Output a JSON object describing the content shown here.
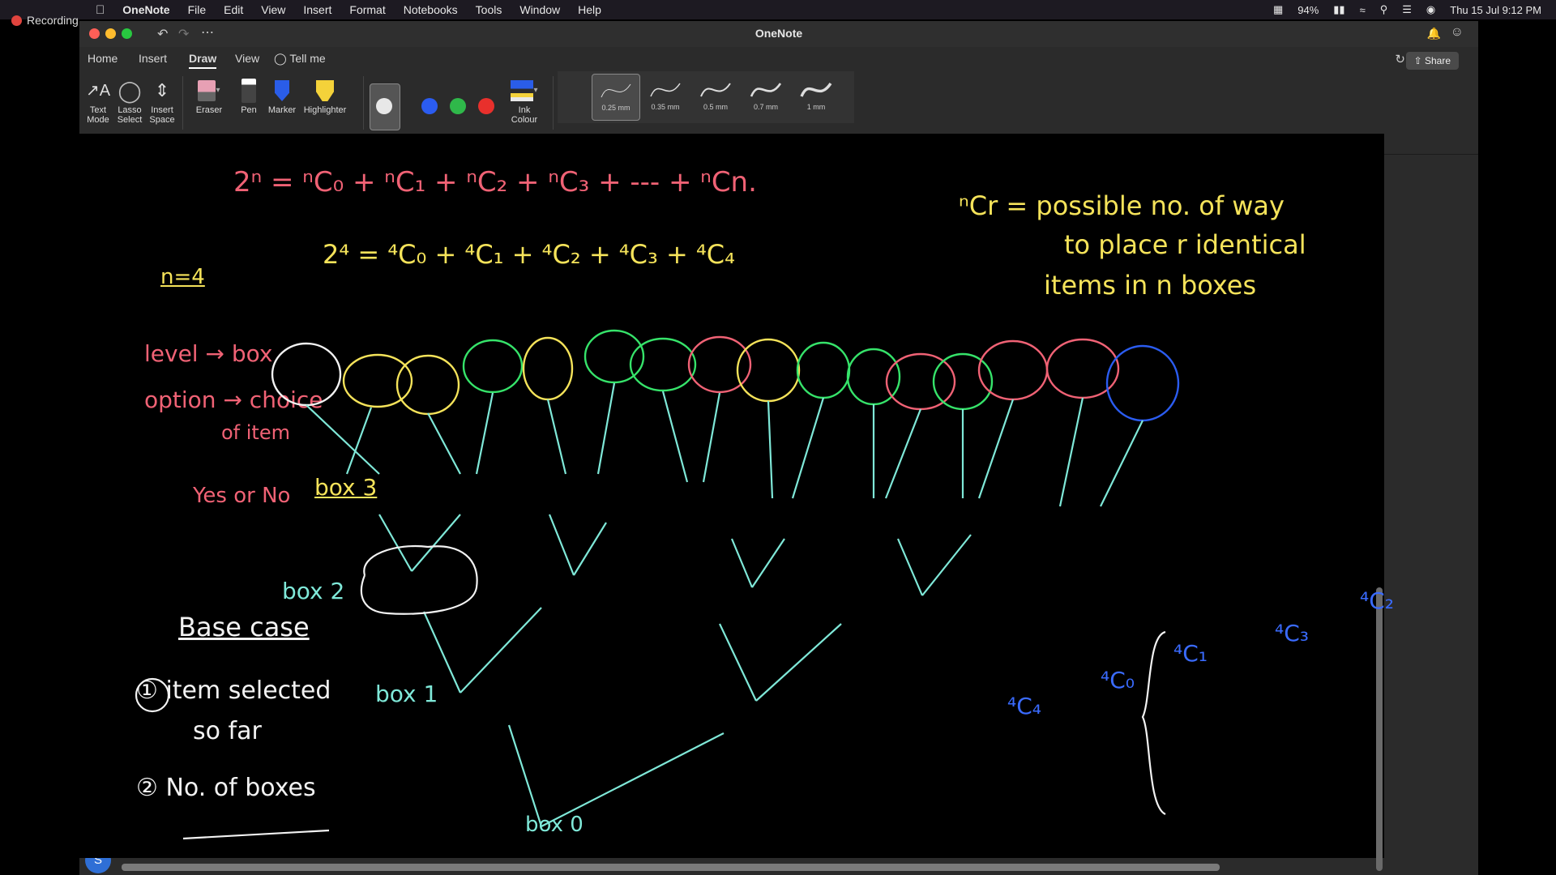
{
  "recording": {
    "label": "Recording"
  },
  "menubar": {
    "app": "OneNote",
    "items": [
      "File",
      "Edit",
      "View",
      "Insert",
      "Format",
      "Notebooks",
      "Tools",
      "Window",
      "Help"
    ],
    "battery": "94%",
    "datetime": "Thu 15 Jul  9:12 PM"
  },
  "window": {
    "title": "OneNote"
  },
  "tabs": [
    "Home",
    "Insert",
    "Draw",
    "View",
    "Tell me"
  ],
  "active_tab": "Draw",
  "share_label": "Share",
  "ribbon": {
    "text_mode": "Text Mode",
    "lasso": "Lasso Select",
    "insert_space": "Insert Space",
    "eraser": "Eraser",
    "pen": "Pen",
    "marker": "Marker",
    "highlighter": "Highlighter",
    "ink_colour": "Ink Colour",
    "colors": [
      "#e8e8e8",
      "#2b5cf0",
      "#2fb84a",
      "#e8302c"
    ],
    "widths": [
      "0.25 mm",
      "0.35 mm",
      "0.5 mm",
      "0.7 mm",
      "1 mm"
    ]
  },
  "avatar": "S",
  "ink": {
    "formula_top": "2ⁿ = ⁿC₀ + ⁿC₁ + ⁿC₂ + ⁿC₃ + ---  + ⁿCn.",
    "formula_n4": "2⁴ = ⁴C₀ + ⁴C₁ + ⁴C₂ + ⁴C₃ + ⁴C₄",
    "n_eq": "n=4",
    "ncr": "ⁿCr = possible no. of way",
    "ncr2": "to place  r  identical",
    "ncr3": "items in  n boxes",
    "level_box": "level → box",
    "option_choice": "option → choice",
    "of_item": "of item",
    "yes_no": "Yes or No",
    "box_label": "box 3",
    "box2": "box 2",
    "box1": "box 1",
    "box0": "box 0",
    "base_case": "Base case",
    "item_selected": "item selected",
    "so_far": "so far",
    "no_boxes": "No. of boxes",
    "c4": "⁴C₄",
    "c0": "⁴C₀",
    "c1": "⁴C₁",
    "c3": "⁴C₃",
    "c2": "⁴C₂"
  }
}
